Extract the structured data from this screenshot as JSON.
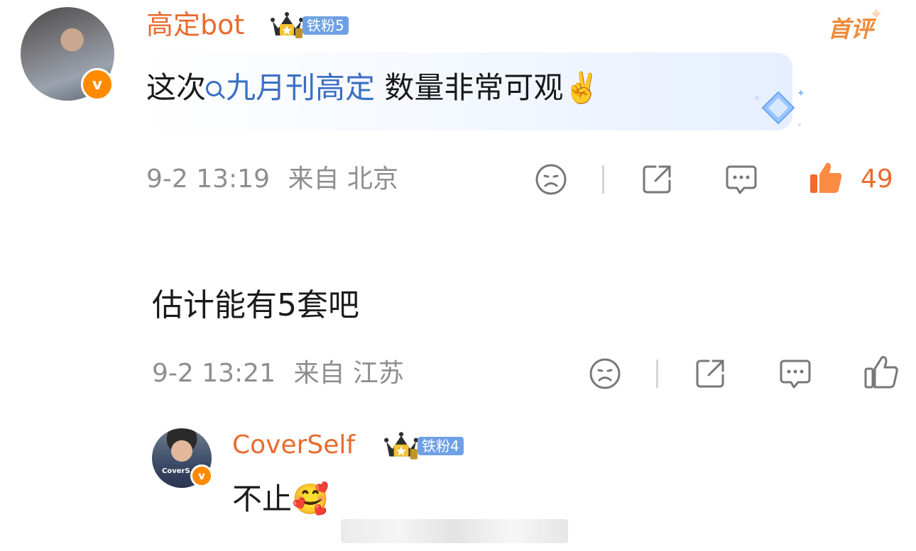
{
  "comments": [
    {
      "username": "高定bot",
      "fan_badge": "铁粉5",
      "first_comment_label": "首评",
      "text_prefix": "这次",
      "topic": "九月刊高定",
      "text_suffix": " 数量非常可观",
      "emoji": "✌️",
      "timestamp": "9-2 13:19",
      "location": "来自 北京",
      "like_count": "49",
      "liked": true
    },
    {
      "text": "估计能有5套吧",
      "timestamp": "9-2 13:21",
      "location": "来自 江苏",
      "liked": false
    }
  ],
  "reply": {
    "username": "CoverSelf",
    "fan_badge": "铁粉4",
    "avatar_text": "CoverS",
    "text": "不止",
    "emoji": "🥰"
  },
  "colors": {
    "username": "#e86c2f",
    "topic_link": "#3a6fc4",
    "meta_text": "#8e8e8e",
    "like_active": "#e86c2f",
    "fans_badge": "#6ea0e6",
    "verified_badge": "#ff8a00"
  },
  "icons": [
    "verified-v-icon",
    "crown-icon",
    "search-icon",
    "sparkle-diamond-icon",
    "dislike-face-icon",
    "share-icon",
    "comment-icon",
    "thumbs-up-icon",
    "flower-emoji-icon"
  ]
}
